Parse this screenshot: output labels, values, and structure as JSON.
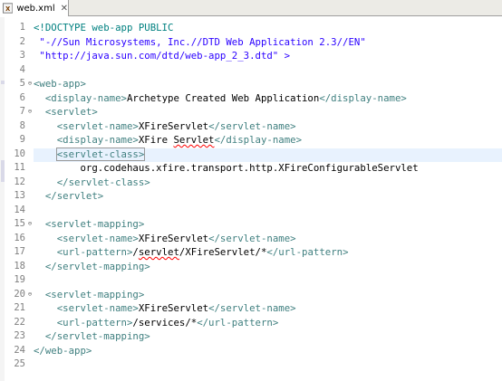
{
  "tab": {
    "label": "web.xml",
    "close": "✕",
    "icon": "xml-file-icon"
  },
  "line_numbers": [
    "1",
    "2",
    "3",
    "4",
    "5",
    "6",
    "7",
    "8",
    "9",
    "10",
    "11",
    "12",
    "13",
    "14",
    "15",
    "16",
    "17",
    "18",
    "19",
    "20",
    "21",
    "22",
    "23",
    "24",
    "25"
  ],
  "fold_markers": [
    "",
    "",
    "",
    "",
    "⊖",
    "",
    "⊖",
    "",
    "",
    "",
    "",
    "",
    "",
    "",
    "⊖",
    "",
    "",
    "",
    "",
    "⊖",
    "",
    "",
    "",
    "",
    ""
  ],
  "code": {
    "l1_doctype": "<!DOCTYPE web-app PUBLIC",
    "l2_public_id": " \"-//Sun Microsystems, Inc.//DTD Web Application 2.3//EN\"",
    "l3_system_id": " \"http://java.sun.com/dtd/web-app_2_3.dtd\" >",
    "l5_open": "<web-app>",
    "l6_open": "<display-name>",
    "l6_text": "Archetype Created Web Application",
    "l6_close": "</display-name>",
    "l7_open": "<servlet>",
    "l8_open": "<servlet-name>",
    "l8_text": "XFireServlet",
    "l8_close": "</servlet-name>",
    "l9_open": "<display-name>",
    "l9_text_a": "XFire ",
    "l9_text_b": "Servlet",
    "l9_close": "</display-name>",
    "l10_open": "<servlet-class>",
    "l11_text": "org.codehaus.xfire.transport.http.XFireConfigurableServlet",
    "l12_close": "</servlet-class>",
    "l13_close": "</servlet>",
    "l15_open": "<servlet-mapping>",
    "l16_open": "<servlet-name>",
    "l16_text": "XFireServlet",
    "l16_close": "</servlet-name>",
    "l17_open": "<url-pattern>",
    "l17_text_a": "/",
    "l17_text_b": "servlet",
    "l17_text_c": "/XFireServlet/*",
    "l17_close": "</url-pattern>",
    "l18_close": "</servlet-mapping>",
    "l20_open": "<servlet-mapping>",
    "l21_open": "<servlet-name>",
    "l21_text": "XFireServlet",
    "l21_close": "</servlet-name>",
    "l22_open": "<url-pattern>",
    "l22_text": "/services/*",
    "l22_close": "</url-pattern>",
    "l23_close": "</servlet-mapping>",
    "l24_close": "</web-app>"
  },
  "colors": {
    "tag": "#3f7f7f",
    "doctype": "#008080",
    "string": "#2a00ff",
    "current_line": "#e8f2fe",
    "tab_bar": "#ecebe6"
  }
}
